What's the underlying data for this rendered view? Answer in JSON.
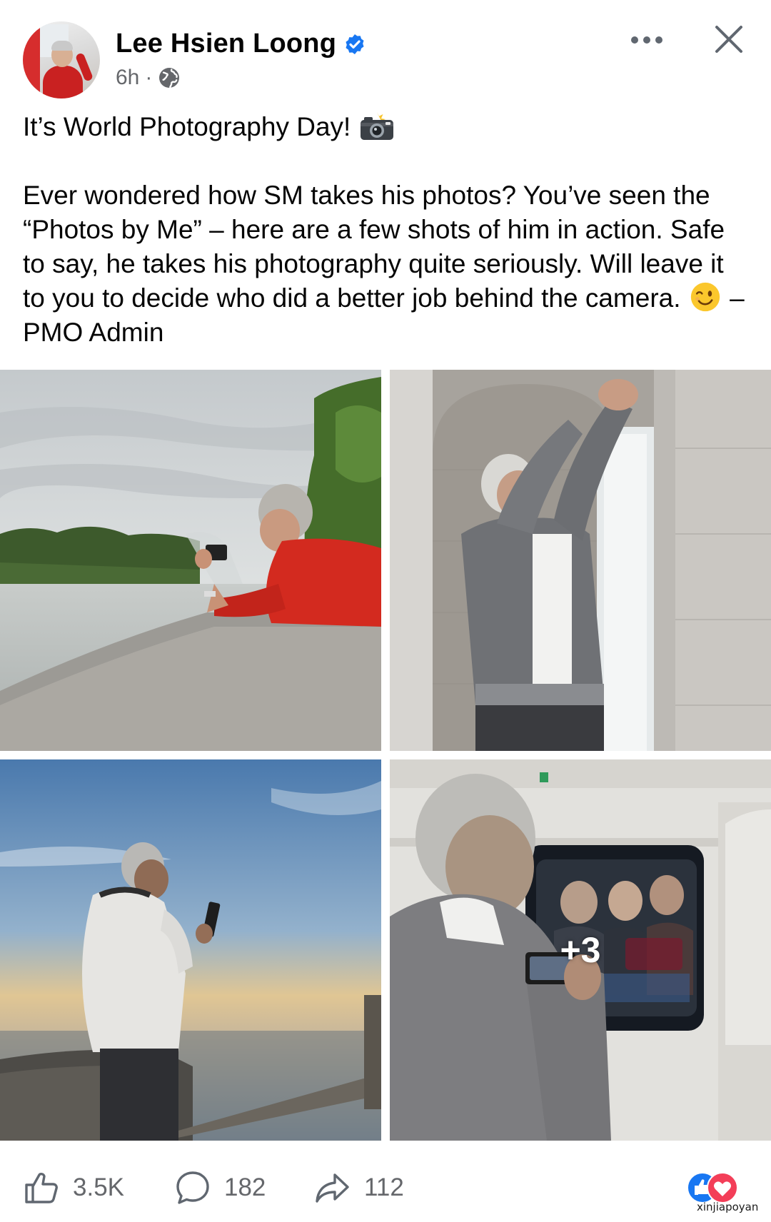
{
  "post": {
    "author": "Lee Hsien Loong",
    "verified": true,
    "time": "6h",
    "separator": "·",
    "audience_icon": "globe-icon",
    "text_line1": "It’s World Photography Day!",
    "text_body": "Ever wondered how SM takes his photos? You’ve seen the “Photos by Me” – here are a few shots of him in action. Safe to say, he takes his photography quite seriously. Will leave it to you to decide who did a better job behind the camera.",
    "text_sign": "– PMO Admin",
    "emojis": [
      "camera-with-flash-emoji",
      "winking-face-emoji"
    ]
  },
  "photos": {
    "more_overlay": "+3"
  },
  "footer": {
    "likes": "3.5K",
    "comments": "182",
    "shares": "112",
    "reaction_icons": [
      "like-reaction-icon",
      "love-reaction-icon"
    ],
    "watermark": "xinjiapoyan"
  },
  "colors": {
    "verified_blue": "#1877f2",
    "text_primary": "#050505",
    "text_secondary": "#65676b",
    "love_red": "#f33e58"
  }
}
